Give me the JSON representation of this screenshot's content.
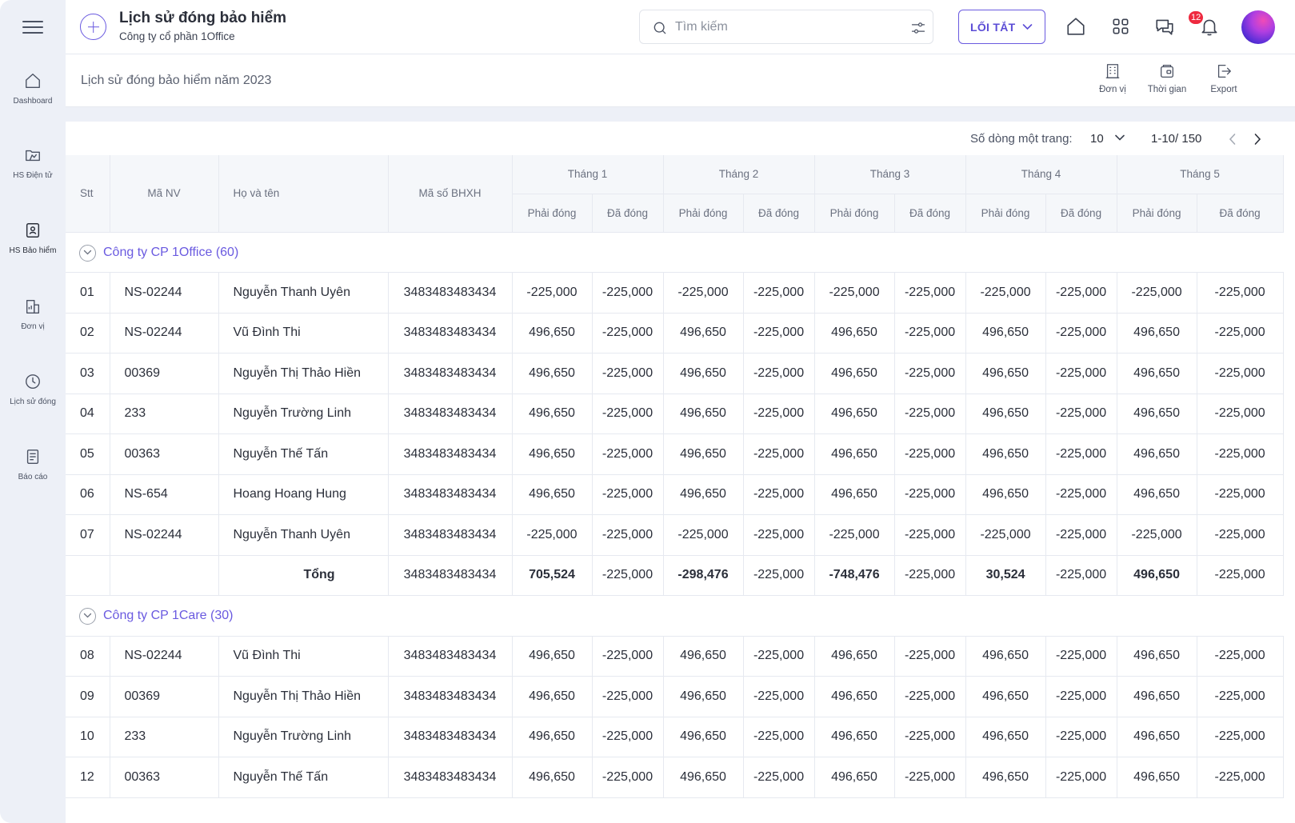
{
  "sidebar": {
    "items": [
      {
        "label": "Dashboard",
        "icon": "home-icon"
      },
      {
        "label": "HS Điện tử",
        "icon": "folder-icon"
      },
      {
        "label": "HS Bảo hiểm",
        "icon": "id-card-icon"
      },
      {
        "label": "Đơn vị",
        "icon": "building-chart-icon"
      },
      {
        "label": "Lịch sử đóng",
        "icon": "clock-icon"
      },
      {
        "label": "Báo cáo",
        "icon": "report-icon"
      }
    ]
  },
  "header": {
    "title": "Lịch sử đóng bảo hiểm",
    "subtitle": "Công ty cổ phần 1Office",
    "search_placeholder": "Tìm kiếm",
    "shortcut_label": "LỐI TẮT",
    "notification_count": "12",
    "accent_color": "#6a5ae0"
  },
  "subheader": {
    "title": "Lịch sử đóng bảo hiểm năm 2023",
    "tools": [
      {
        "label": "Đơn vị",
        "icon": "building-icon"
      },
      {
        "label": "Thời gian",
        "icon": "wallet-icon"
      },
      {
        "label": "Export",
        "icon": "export-icon"
      }
    ]
  },
  "pagination": {
    "rows_per_page_label": "Số dòng một trang:",
    "rows_per_page": "10",
    "range": "1-10/ 150"
  },
  "table": {
    "headers": {
      "stt": "Stt",
      "ma_nv": "Mã NV",
      "ho_ten": "Họ và tên",
      "ma_bhxh": "Mã số BHXH",
      "months": [
        "Tháng 1",
        "Tháng 2",
        "Tháng 3",
        "Tháng 4",
        "Tháng 5"
      ],
      "phai_dong": "Phải đóng",
      "da_dong": "Đã đóng"
    },
    "groups": [
      {
        "label": "Công ty CP 1Office (60)",
        "rows": [
          {
            "stt": "01",
            "ma_nv": "NS-02244",
            "ho_ten": "Nguyễn Thanh Uyên",
            "bhxh": "3483483483434",
            "values": [
              "-225,000",
              "-225,000",
              "-225,000",
              "-225,000",
              "-225,000",
              "-225,000",
              "-225,000",
              "-225,000",
              "-225,000",
              "-225,000"
            ]
          },
          {
            "stt": "02",
            "ma_nv": "NS-02244",
            "ho_ten": "Vũ Đình Thi",
            "bhxh": "3483483483434",
            "values": [
              "496,650",
              "-225,000",
              "496,650",
              "-225,000",
              "496,650",
              "-225,000",
              "496,650",
              "-225,000",
              "496,650",
              "-225,000"
            ]
          },
          {
            "stt": "03",
            "ma_nv": "00369",
            "ho_ten": "Nguyễn Thị Thảo Hiền",
            "bhxh": "3483483483434",
            "values": [
              "496,650",
              "-225,000",
              "496,650",
              "-225,000",
              "496,650",
              "-225,000",
              "496,650",
              "-225,000",
              "496,650",
              "-225,000"
            ]
          },
          {
            "stt": "04",
            "ma_nv": "233",
            "ho_ten": "Nguyễn Trường Linh",
            "bhxh": "3483483483434",
            "values": [
              "496,650",
              "-225,000",
              "496,650",
              "-225,000",
              "496,650",
              "-225,000",
              "496,650",
              "-225,000",
              "496,650",
              "-225,000"
            ]
          },
          {
            "stt": "05",
            "ma_nv": "00363",
            "ho_ten": "Nguyễn Thế Tấn",
            "bhxh": "3483483483434",
            "values": [
              "496,650",
              "-225,000",
              "496,650",
              "-225,000",
              "496,650",
              "-225,000",
              "496,650",
              "-225,000",
              "496,650",
              "-225,000"
            ]
          },
          {
            "stt": "06",
            "ma_nv": "NS-654",
            "ho_ten": "Hoang Hoang Hung",
            "bhxh": "3483483483434",
            "values": [
              "496,650",
              "-225,000",
              "496,650",
              "-225,000",
              "496,650",
              "-225,000",
              "496,650",
              "-225,000",
              "496,650",
              "-225,000"
            ]
          },
          {
            "stt": "07",
            "ma_nv": "NS-02244",
            "ho_ten": "Nguyễn Thanh Uyên",
            "bhxh": "3483483483434",
            "values": [
              "-225,000",
              "-225,000",
              "-225,000",
              "-225,000",
              "-225,000",
              "-225,000",
              "-225,000",
              "-225,000",
              "-225,000",
              "-225,000"
            ]
          }
        ],
        "total": {
          "label": "Tổng",
          "bhxh": "3483483483434",
          "values": [
            "705,524",
            "-225,000",
            "-298,476",
            "-225,000",
            "-748,476",
            "-225,000",
            "30,524",
            "-225,000",
            "496,650",
            "-225,000"
          ]
        }
      },
      {
        "label": "Công ty CP 1Care (30)",
        "rows": [
          {
            "stt": "08",
            "ma_nv": "NS-02244",
            "ho_ten": "Vũ Đình Thi",
            "bhxh": "3483483483434",
            "values": [
              "496,650",
              "-225,000",
              "496,650",
              "-225,000",
              "496,650",
              "-225,000",
              "496,650",
              "-225,000",
              "496,650",
              "-225,000"
            ]
          },
          {
            "stt": "09",
            "ma_nv": "00369",
            "ho_ten": "Nguyễn Thị Thảo Hiền",
            "bhxh": "3483483483434",
            "values": [
              "496,650",
              "-225,000",
              "496,650",
              "-225,000",
              "496,650",
              "-225,000",
              "496,650",
              "-225,000",
              "496,650",
              "-225,000"
            ]
          },
          {
            "stt": "10",
            "ma_nv": "233",
            "ho_ten": "Nguyễn Trường Linh",
            "bhxh": "3483483483434",
            "values": [
              "496,650",
              "-225,000",
              "496,650",
              "-225,000",
              "496,650",
              "-225,000",
              "496,650",
              "-225,000",
              "496,650",
              "-225,000"
            ]
          },
          {
            "stt": "12",
            "ma_nv": "00363",
            "ho_ten": "Nguyễn Thế Tấn",
            "bhxh": "3483483483434",
            "values": [
              "496,650",
              "-225,000",
              "496,650",
              "-225,000",
              "496,650",
              "-225,000",
              "496,650",
              "-225,000",
              "496,650",
              "-225,000"
            ]
          }
        ]
      }
    ]
  }
}
